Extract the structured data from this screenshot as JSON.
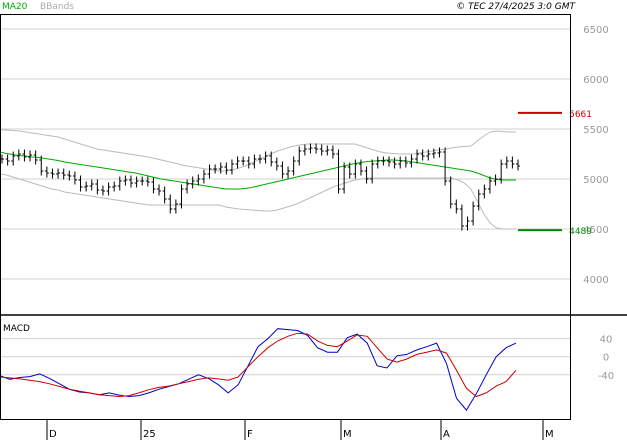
{
  "header": {
    "ma_label": "MA20",
    "bb_label": "BBands",
    "copyright": "© TEC 27/4/2025 3:0 GMT"
  },
  "colors": {
    "ma": "#00aa00",
    "bands": "#bbbbbb",
    "price": "#000000",
    "resistance": "#cc0000",
    "support": "#008800",
    "macd": "#0000cc",
    "signal": "#cc0000",
    "grid": "#d0d0d0"
  },
  "chart_data": [
    {
      "type": "line",
      "title": "",
      "panel": "price",
      "ylim": [
        3650,
        6650
      ],
      "y_ticks": [
        4000,
        4500,
        5000,
        5500,
        6000,
        6500
      ],
      "y_tick_labels": [
        "4000",
        "4500",
        "5000",
        "5500",
        "6000",
        "6500"
      ],
      "x_ticks": [
        "D",
        "25",
        "F",
        "M",
        "A",
        "M"
      ],
      "grid": true,
      "legend": "top-left",
      "levels": [
        {
          "name": "resistance",
          "value": 5661,
          "label": "5661"
        },
        {
          "name": "support",
          "value": 4489,
          "label": "4489"
        }
      ],
      "series": [
        {
          "name": "MA20",
          "style": "line",
          "values": [
            5270,
            5255,
            5245,
            5235,
            5230,
            5220,
            5215,
            5205,
            5195,
            5185,
            5170,
            5160,
            5150,
            5140,
            5130,
            5120,
            5110,
            5100,
            5090,
            5080,
            5070,
            5060,
            5045,
            5030,
            5015,
            5000,
            4990,
            4980,
            4970,
            4960,
            4950,
            4940,
            4930,
            4920,
            4910,
            4900,
            4900,
            4900,
            4905,
            4915,
            4930,
            4945,
            4960,
            4975,
            4990,
            5005,
            5020,
            5035,
            5050,
            5065,
            5080,
            5095,
            5110,
            5125,
            5140,
            5155,
            5165,
            5175,
            5180,
            5185,
            5190,
            5190,
            5185,
            5180,
            5170,
            5160,
            5150,
            5140,
            5130,
            5120,
            5110,
            5100,
            5090,
            5080,
            5060,
            5035,
            5010,
            4995,
            4990,
            4990,
            4990
          ]
        },
        {
          "name": "BBands",
          "style": "band",
          "role": "upper",
          "values": [
            5490,
            5490,
            5485,
            5480,
            5470,
            5460,
            5450,
            5440,
            5430,
            5420,
            5400,
            5380,
            5360,
            5340,
            5320,
            5300,
            5290,
            5280,
            5270,
            5260,
            5250,
            5240,
            5230,
            5220,
            5205,
            5190,
            5175,
            5160,
            5145,
            5130,
            5120,
            5110,
            5100,
            5090,
            5080,
            5080,
            5090,
            5110,
            5130,
            5160,
            5190,
            5220,
            5250,
            5280,
            5300,
            5320,
            5335,
            5345,
            5350,
            5350,
            5350,
            5350,
            5350,
            5350,
            5350,
            5350,
            5330,
            5310,
            5290,
            5270,
            5260,
            5255,
            5250,
            5250,
            5250,
            5260,
            5270,
            5280,
            5290,
            5300,
            5310,
            5320,
            5325,
            5330,
            5380,
            5430,
            5470,
            5480,
            5475,
            5470,
            5470
          ]
        },
        {
          "name": "BBands",
          "style": "band",
          "role": "lower",
          "values": [
            5050,
            5040,
            5020,
            5000,
            4980,
            4960,
            4940,
            4920,
            4900,
            4890,
            4870,
            4860,
            4850,
            4840,
            4830,
            4820,
            4810,
            4800,
            4790,
            4780,
            4770,
            4760,
            4750,
            4740,
            4740,
            4740,
            4740,
            4740,
            4740,
            4740,
            4740,
            4740,
            4740,
            4740,
            4740,
            4720,
            4710,
            4700,
            4695,
            4690,
            4685,
            4680,
            4680,
            4690,
            4710,
            4730,
            4750,
            4780,
            4810,
            4840,
            4870,
            4900,
            4930,
            4950,
            4970,
            4990,
            5000,
            5010,
            5010,
            5010,
            5010,
            5010,
            5010,
            5010,
            5010,
            5010,
            5010,
            5010,
            5010,
            5010,
            5010,
            4990,
            4960,
            4900,
            4780,
            4650,
            4560,
            4510,
            4500,
            4500,
            4500
          ]
        },
        {
          "name": "Price",
          "style": "bars",
          "values": [
            5200,
            5180,
            5230,
            5250,
            5220,
            5240,
            5190,
            5080,
            5060,
            5050,
            5060,
            5040,
            5030,
            4990,
            4920,
            4930,
            4950,
            4890,
            4880,
            4920,
            4930,
            4980,
            4990,
            4960,
            4980,
            4980,
            4970,
            4900,
            4880,
            4800,
            4700,
            4750,
            4900,
            4950,
            4980,
            5000,
            5050,
            5100,
            5100,
            5120,
            5090,
            5150,
            5180,
            5180,
            5150,
            5200,
            5200,
            5230,
            5170,
            5130,
            5050,
            5080,
            5180,
            5280,
            5300,
            5310,
            5300,
            5280,
            5290,
            5250,
            4900,
            5120,
            5050,
            5150,
            5080,
            5000,
            5150,
            5180,
            5180,
            5170,
            5150,
            5180,
            5160,
            5200,
            5250,
            5230,
            5250,
            5260,
            5270,
            4980,
            4750,
            4700,
            4530,
            4580,
            4730,
            4850,
            4900,
            4980,
            5000,
            5150,
            5180,
            5150,
            5130
          ]
        }
      ]
    },
    {
      "type": "line",
      "title": "MACD",
      "panel": "macd",
      "ylim": [
        -140,
        90
      ],
      "y_ticks": [
        40,
        0,
        -40
      ],
      "y_tick_labels": [
        "40",
        "0",
        "-40"
      ],
      "grid": true,
      "series": [
        {
          "name": "MACD",
          "values": [
            -42,
            -50,
            -46,
            -44,
            -38,
            -48,
            -60,
            -72,
            -78,
            -80,
            -84,
            -80,
            -85,
            -88,
            -86,
            -80,
            -72,
            -66,
            -60,
            -50,
            -40,
            -48,
            -62,
            -80,
            -62,
            -20,
            22,
            40,
            62,
            60,
            58,
            47,
            20,
            10,
            10,
            42,
            50,
            30,
            -20,
            -25,
            2,
            5,
            15,
            22,
            30,
            -15,
            -92,
            -118,
            -82,
            -40,
            0,
            20,
            30
          ]
        },
        {
          "name": "Signal",
          "values": [
            -45,
            -47,
            -49,
            -52,
            -55,
            -60,
            -66,
            -72,
            -76,
            -80,
            -84,
            -86,
            -88,
            -86,
            -80,
            -73,
            -68,
            -65,
            -60,
            -55,
            -50,
            -47,
            -49,
            -52,
            -45,
            -22,
            0,
            20,
            35,
            45,
            52,
            50,
            35,
            25,
            22,
            35,
            48,
            45,
            20,
            -5,
            -12,
            -5,
            5,
            10,
            15,
            8,
            -30,
            -70,
            -88,
            -80,
            -65,
            -55,
            -30
          ]
        }
      ]
    }
  ]
}
